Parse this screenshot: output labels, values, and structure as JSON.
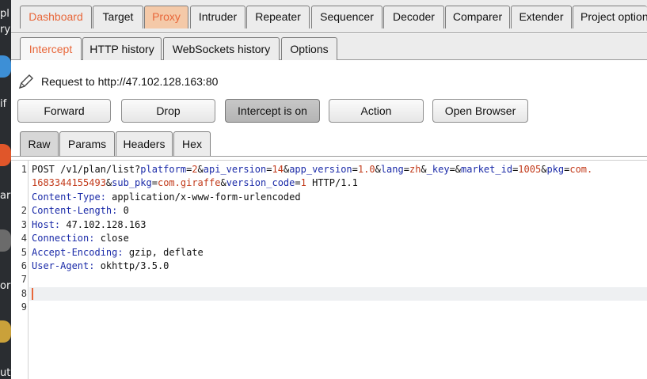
{
  "main_tabs": [
    {
      "label": "Dashboard",
      "accent": true
    },
    {
      "label": "Target"
    },
    {
      "label": "Proxy",
      "accent": true,
      "active": true
    },
    {
      "label": "Intruder"
    },
    {
      "label": "Repeater"
    },
    {
      "label": "Sequencer"
    },
    {
      "label": "Decoder"
    },
    {
      "label": "Comparer"
    },
    {
      "label": "Extender"
    },
    {
      "label": "Project options"
    }
  ],
  "sub_tabs": [
    {
      "label": "Intercept",
      "active": true
    },
    {
      "label": "HTTP history"
    },
    {
      "label": "WebSockets history"
    },
    {
      "label": "Options"
    }
  ],
  "request": {
    "label": "Request to http://47.102.128.163:80"
  },
  "buttons": {
    "forward": "Forward",
    "drop": "Drop",
    "intercept": "Intercept is on",
    "action": "Action",
    "open_browser": "Open Browser"
  },
  "editor_tabs": [
    {
      "label": "Raw",
      "active": true
    },
    {
      "label": "Params"
    },
    {
      "label": "Headers"
    },
    {
      "label": "Hex"
    }
  ],
  "editor": {
    "line_numbers": [
      "1",
      "2",
      "3",
      "4",
      "5",
      "6",
      "7",
      "8",
      "9"
    ],
    "request_line": {
      "method_path": "POST /v1/plan/list?",
      "params": [
        {
          "name": "platform",
          "value": "2"
        },
        {
          "name": "api_version",
          "value": "14"
        },
        {
          "name": "app_version",
          "value": "1.0"
        },
        {
          "name": "lang",
          "value": "zh"
        },
        {
          "name": "_key",
          "value": ""
        },
        {
          "name": "market_id",
          "value": "1005"
        },
        {
          "name": "pkg",
          "value": "com."
        }
      ],
      "wrap_value": "1683344155493",
      "params2": [
        {
          "name": "sub_pkg",
          "value": "com.giraffe"
        },
        {
          "name": "version_code",
          "value": "1"
        }
      ],
      "protocol": " HTTP/1.1"
    },
    "headers": [
      {
        "name": "Content-Type",
        "value": "application/x-www-form-urlencoded"
      },
      {
        "name": "Content-Length",
        "value": "0"
      },
      {
        "name": "Host",
        "value": "47.102.128.163"
      },
      {
        "name": "Connection",
        "value": "close"
      },
      {
        "name": "Accept-Encoding",
        "value": "gzip, deflate"
      },
      {
        "name": "User-Agent",
        "value": "okhttp/3.5.0"
      }
    ]
  },
  "desktop_fragments": [
    "pl",
    "ry",
    "if",
    "ar",
    "orr",
    "ut"
  ],
  "colors": {
    "accent": "#e8673a",
    "header_name": "#1a2aa8",
    "param_value": "#c23a1a",
    "active_tab": "#f4c9a8"
  }
}
